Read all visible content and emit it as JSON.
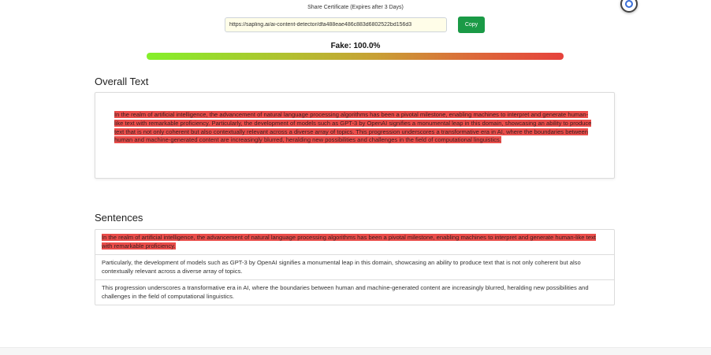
{
  "share": {
    "title": "Share Certificate (Expires after 3 Days)",
    "url_value": "https://sapling.ai/ai-content-detector/dfa488eae486c883d6802522bd156d3",
    "copy_label": "Copy"
  },
  "score": {
    "label": "Fake: 100.0%",
    "fake_fraction": 1.0
  },
  "overall": {
    "heading": "Overall Text",
    "text": "In the realm of artificial intelligence, the advancement of natural language processing algorithms has been a pivotal milestone, enabling machines to interpret and generate human-like text with remarkable proficiency. Particularly, the development of models such as GPT-3 by OpenAI signifies a monumental leap in this domain, showcasing an ability to produce text that is not only coherent but also contextually relevant across a diverse array of topics. This progression underscores a transformative era in AI, where the boundaries between human and machine-generated content are increasingly blurred, heralding new possibilities and challenges in the field of computational linguistics.",
    "highlighted": true
  },
  "sentences": {
    "heading": "Sentences",
    "items": [
      {
        "text": "In the realm of artificial intelligence, the advancement of natural language processing algorithms has been a pivotal milestone, enabling machines to interpret and generate human-like text with remarkable proficiency.",
        "highlighted": true
      },
      {
        "text": "Particularly, the development of models such as GPT-3 by OpenAI signifies a monumental leap in this domain, showcasing an ability to produce text that is not only coherent but also contextually relevant across a diverse array of topics.",
        "highlighted": false
      },
      {
        "text": "This progression underscores a transformative era in AI, where the boundaries between human and machine-generated content are increasingly blurred, heralding new possibilities and challenges in the field of computational linguistics.",
        "highlighted": false
      }
    ]
  },
  "colors": {
    "highlight": "#ea4d4a",
    "copy_button": "#1a9a46",
    "gradient_start": "#84f02a",
    "gradient_end": "#e6423c"
  },
  "icons": {
    "extension": "browser-extension-icon"
  }
}
